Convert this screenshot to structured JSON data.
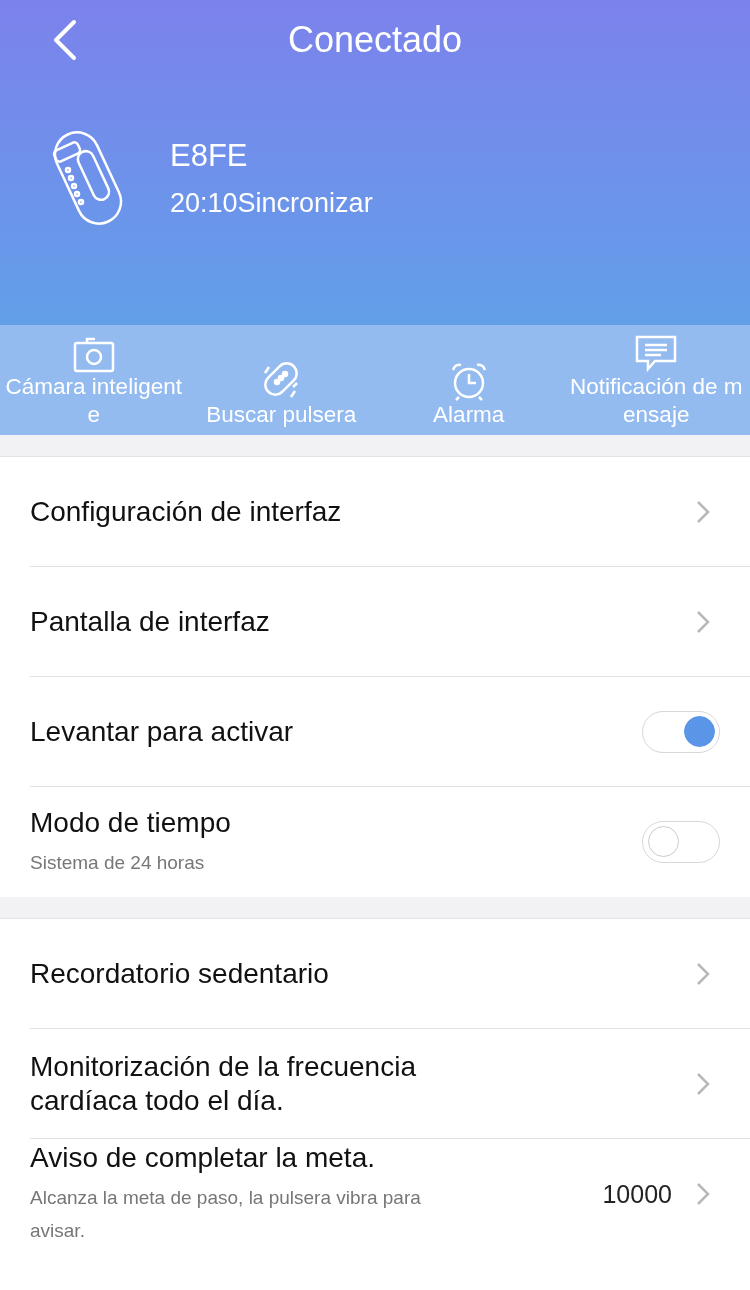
{
  "header": {
    "title": "Conectado"
  },
  "device": {
    "name": "E8FE",
    "sync": "20:10Sincronizar"
  },
  "actions": [
    {
      "kind": "camera",
      "label": "Cámara inteligente"
    },
    {
      "kind": "find",
      "label": "Buscar pulsera"
    },
    {
      "kind": "alarm",
      "label": "Alarma"
    },
    {
      "kind": "message",
      "label": "Notificación de mensaje"
    }
  ],
  "sections": [
    {
      "rows": [
        {
          "kind": "link",
          "label": "Configuración de interfaz"
        },
        {
          "kind": "link",
          "label": "Pantalla de interfaz"
        },
        {
          "kind": "toggle",
          "label": "Levantar para activar",
          "on": true
        },
        {
          "kind": "toggle",
          "label": "Modo de tiempo",
          "subtitle": "Sistema de 24 horas",
          "on": false
        }
      ]
    },
    {
      "rows": [
        {
          "kind": "link",
          "label": "Recordatorio sedentario"
        },
        {
          "kind": "link",
          "label": "Monitorización de la frecuencia cardíaca todo el día."
        },
        {
          "kind": "link",
          "label": "Aviso de completar la meta.",
          "subtitle": "Alcanza la meta de paso, la pulsera vibra para avisar.",
          "value": "10000"
        }
      ]
    }
  ]
}
